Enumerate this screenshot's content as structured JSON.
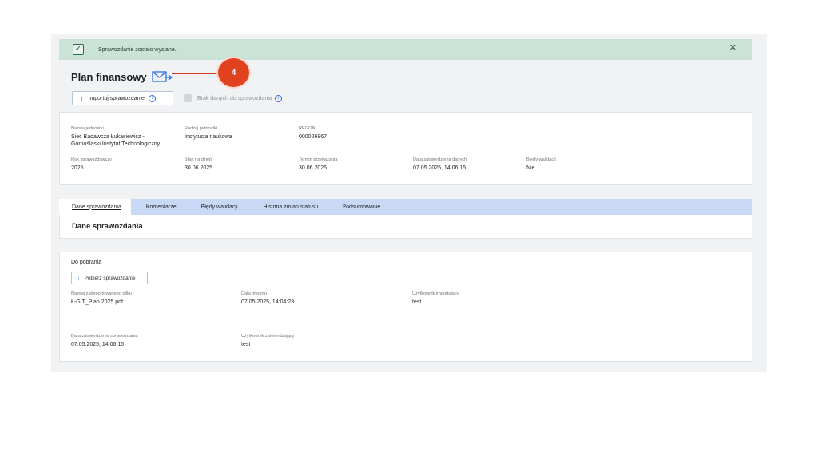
{
  "alert": {
    "message": "Sprawozdanie zostało wysłane.",
    "check_icon": "✓",
    "close_icon": "✕"
  },
  "page": {
    "title": "Plan finansowy",
    "send_icon": "envelope-arrow-icon"
  },
  "callout": {
    "number": "4"
  },
  "toolbar": {
    "import_label": "Importuj sprawozdanie",
    "import_arrow": "↑",
    "info_glyph": "i",
    "no_data_label": "Brak danych do sprawozdania"
  },
  "info": {
    "unit_name_label": "Nazwa jednostki",
    "unit_name_line1": "Sieć Badawcza Łukasiewicz -",
    "unit_name_line2": "Górnośląski Instytut Technologiczny",
    "unit_type_label": "Rodzaj jednostki",
    "unit_type": "Instytucja naukowa",
    "regon_label": "REGON",
    "regon": "000026867",
    "year_label": "Rok sprawozdawczy",
    "year": "2025",
    "as_of_label": "Stan na dzień",
    "as_of": "30.06.2025",
    "deadline_label": "Termin przekazania",
    "deadline": "30.06.2025",
    "approval_date_label": "Data zatwierdzenia danych",
    "approval_date": "07.05.2025, 14:06:15",
    "errors_label": "Błędy walidacji",
    "errors": "Nie"
  },
  "tabs": [
    {
      "label": "Dane sprawozdania"
    },
    {
      "label": "Komentarze"
    },
    {
      "label": "Błędy walidacji"
    },
    {
      "label": "Historia zmian statusu"
    },
    {
      "label": "Podsumowanie"
    }
  ],
  "section": {
    "title": "Dane sprawozdania"
  },
  "download": {
    "title": "Do pobrania",
    "button_label": "Pobierz sprawozdanie",
    "button_arrow": "↓",
    "file_name_label": "Nazwa zaimportowanego pliku",
    "file_name": "Ł-GIT_Plan 2025.pdf",
    "import_date_label": "Data importu",
    "import_date": "07.05.2025, 14:04:23",
    "importing_user_label": "Użytkownik importujący",
    "importing_user": "test",
    "report_approval_label": "Data zatwierdzenia sprawozdania",
    "report_approval": "07.05.2025, 14:06:15",
    "approving_user_label": "Użytkownik zatwierdzający",
    "approving_user": "test"
  },
  "colors": {
    "alert_bg": "#c9e4d6",
    "tab_bar": "#c9d8f5",
    "callout": "#e0421f",
    "info_blue": "#2f6fe6"
  }
}
